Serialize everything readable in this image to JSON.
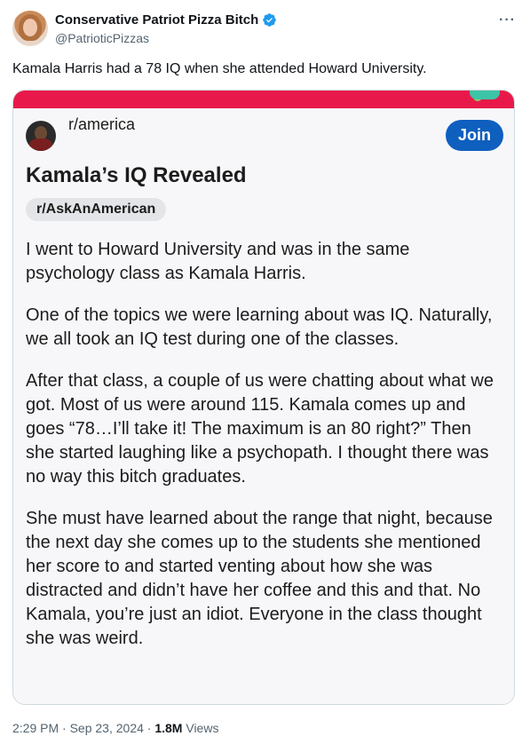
{
  "author": {
    "display_name": "Conservative Patriot Pizza Bitch",
    "handle": "@PatrioticPizzas",
    "verified_icon": "verified-badge-icon",
    "more_label": "···"
  },
  "tweet": {
    "text": "Kamala Harris had a 78 IQ when she attended Howard University."
  },
  "media": {
    "subreddit": "r/america",
    "join_label": "Join",
    "post_title": "Kamala’s IQ Revealed",
    "flair": "r/AskAnAmerican",
    "paragraphs": [
      "I went to Howard University and was in the same psychology class as Kamala Harris.",
      "One of the topics we were learning about was IQ. Naturally, we all took an IQ test during one of the classes.",
      "After that class, a couple of us were chatting about what we got. Most of us were around 115. Kamala comes up and goes “78…I’ll take it! The maximum is an 80 right?” Then she started laughing like a psychopath. I thought there was no way this bitch graduates.",
      "She must have learned about the range that night, because the next day she comes up to the students she mentioned her score to and started venting about how she was distracted and didn’t have her coffee and this and that. No Kamala, you’re just an idiot. Everyone in the class thought she was weird."
    ],
    "accent_color": "#e8194a",
    "join_color": "#0f5fbf"
  },
  "meta": {
    "time": "2:29 PM",
    "separator": " · ",
    "date": "Sep 23, 2024",
    "views_count": "1.8M",
    "views_label": " Views"
  }
}
